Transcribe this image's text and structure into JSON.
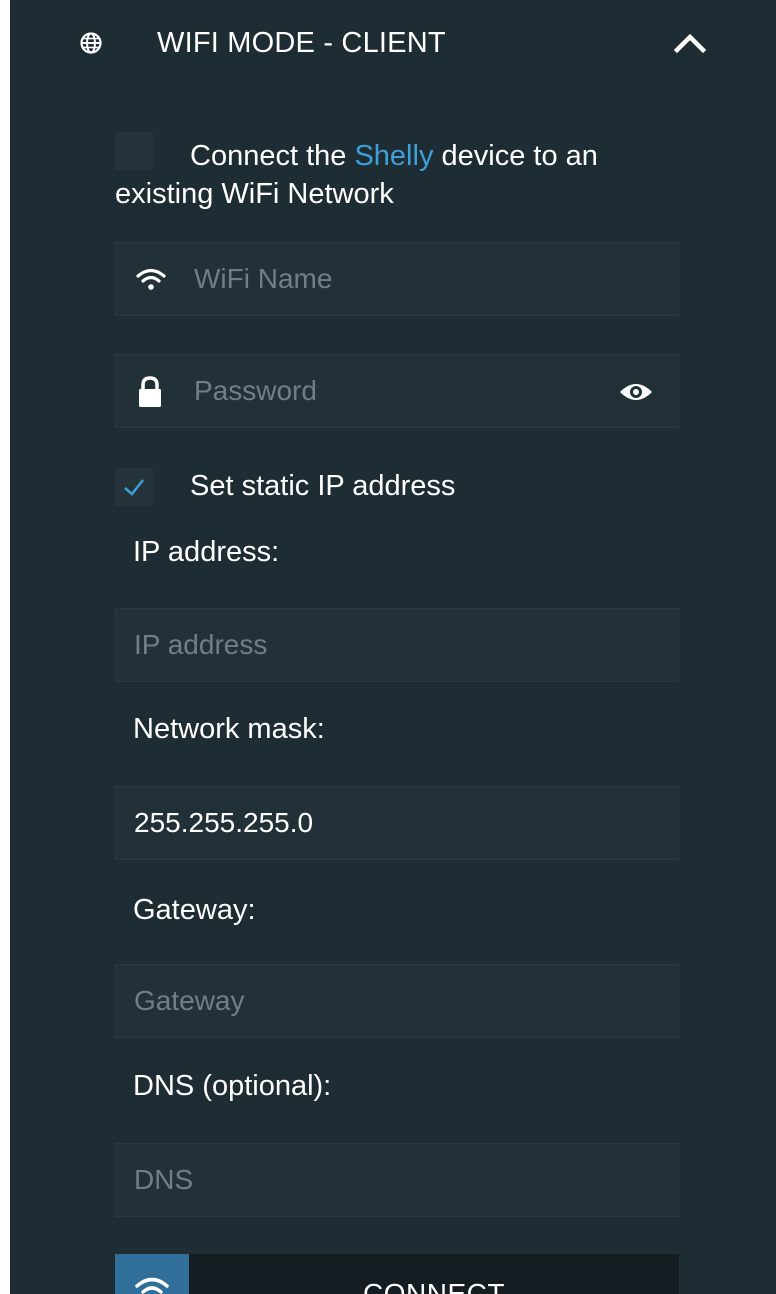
{
  "header": {
    "title": "WIFI MODE - CLIENT",
    "icon": "globe-icon",
    "toggle_icon": "chevron-up-icon"
  },
  "client_mode": {
    "checked": false,
    "text_before": "Connect the ",
    "link_text": "Shelly",
    "text_after": " device to an existing WiFi Network"
  },
  "wifi_name": {
    "placeholder": "WiFi Name",
    "value": "",
    "icon": "wifi-icon"
  },
  "password": {
    "placeholder": "Password",
    "value": "",
    "icon": "lock-icon",
    "toggle_icon": "eye-icon"
  },
  "static_ip": {
    "checked": true,
    "label": "Set static IP address"
  },
  "ip_address": {
    "label": "IP address:",
    "placeholder": "IP address",
    "value": ""
  },
  "network_mask": {
    "label": "Network mask:",
    "placeholder": "",
    "value": "255.255.255.0"
  },
  "gateway": {
    "label": "Gateway:",
    "placeholder": "Gateway",
    "value": ""
  },
  "dns": {
    "label": "DNS (optional):",
    "placeholder": "DNS",
    "value": ""
  },
  "connect_button": {
    "label": "CONNECT",
    "icon": "wifi-icon"
  },
  "colors": {
    "panel_bg": "#1e2c33",
    "field_bg": "#223138",
    "accent": "#3f9fd8",
    "button_icon_bg": "#2f6f9a",
    "text": "#ffffff",
    "placeholder": "#6f7f86"
  }
}
